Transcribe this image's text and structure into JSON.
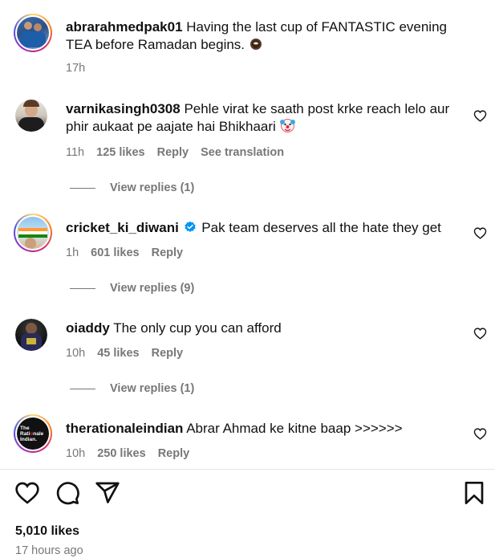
{
  "comments": [
    {
      "username": "abrarahmedpak01",
      "text": "Having the last cup of FANTASTIC evening TEA before Ramadan begins.",
      "emoji": "tea-cup",
      "time": "17h",
      "likes": "",
      "reply": "",
      "translation": ""
    },
    {
      "username": "varnikasingh0308",
      "text": "Pehle virat ke saath post krke reach lelo aur phir aukaat pe aajate hai Bhikhaari",
      "emoji": "clown-face",
      "time": "11h",
      "likes": "125 likes",
      "reply": "Reply",
      "translation": "See translation",
      "view_replies": "View replies (1)"
    },
    {
      "username": "cricket_ki_diwani",
      "verified": true,
      "text": "Pak team deserves all the hate they get",
      "time": "1h",
      "likes": "601 likes",
      "reply": "Reply",
      "view_replies": "View replies (9)"
    },
    {
      "username": "oiaddy",
      "text": "The only cup you can afford",
      "time": "10h",
      "likes": "45 likes",
      "reply": "Reply",
      "view_replies": "View replies (1)"
    },
    {
      "username": "therationaleindian",
      "text": "Abrar Ahmad ke kitne baap >>>>>>",
      "time": "10h",
      "likes": "250 likes",
      "reply": "Reply",
      "avatar_text": [
        "The",
        "Rati",
        "nale",
        "Indian."
      ]
    }
  ],
  "post": {
    "likes": "5,010 likes",
    "time_ago": "17 hours ago"
  },
  "icons": {
    "like": "heart-icon",
    "comment": "comment-bubble-icon",
    "share": "paper-plane-icon",
    "save": "bookmark-icon",
    "verified": "verified-badge-icon"
  },
  "colors": {
    "text": "#111111",
    "muted": "#777777",
    "verified": "#0095f6"
  }
}
